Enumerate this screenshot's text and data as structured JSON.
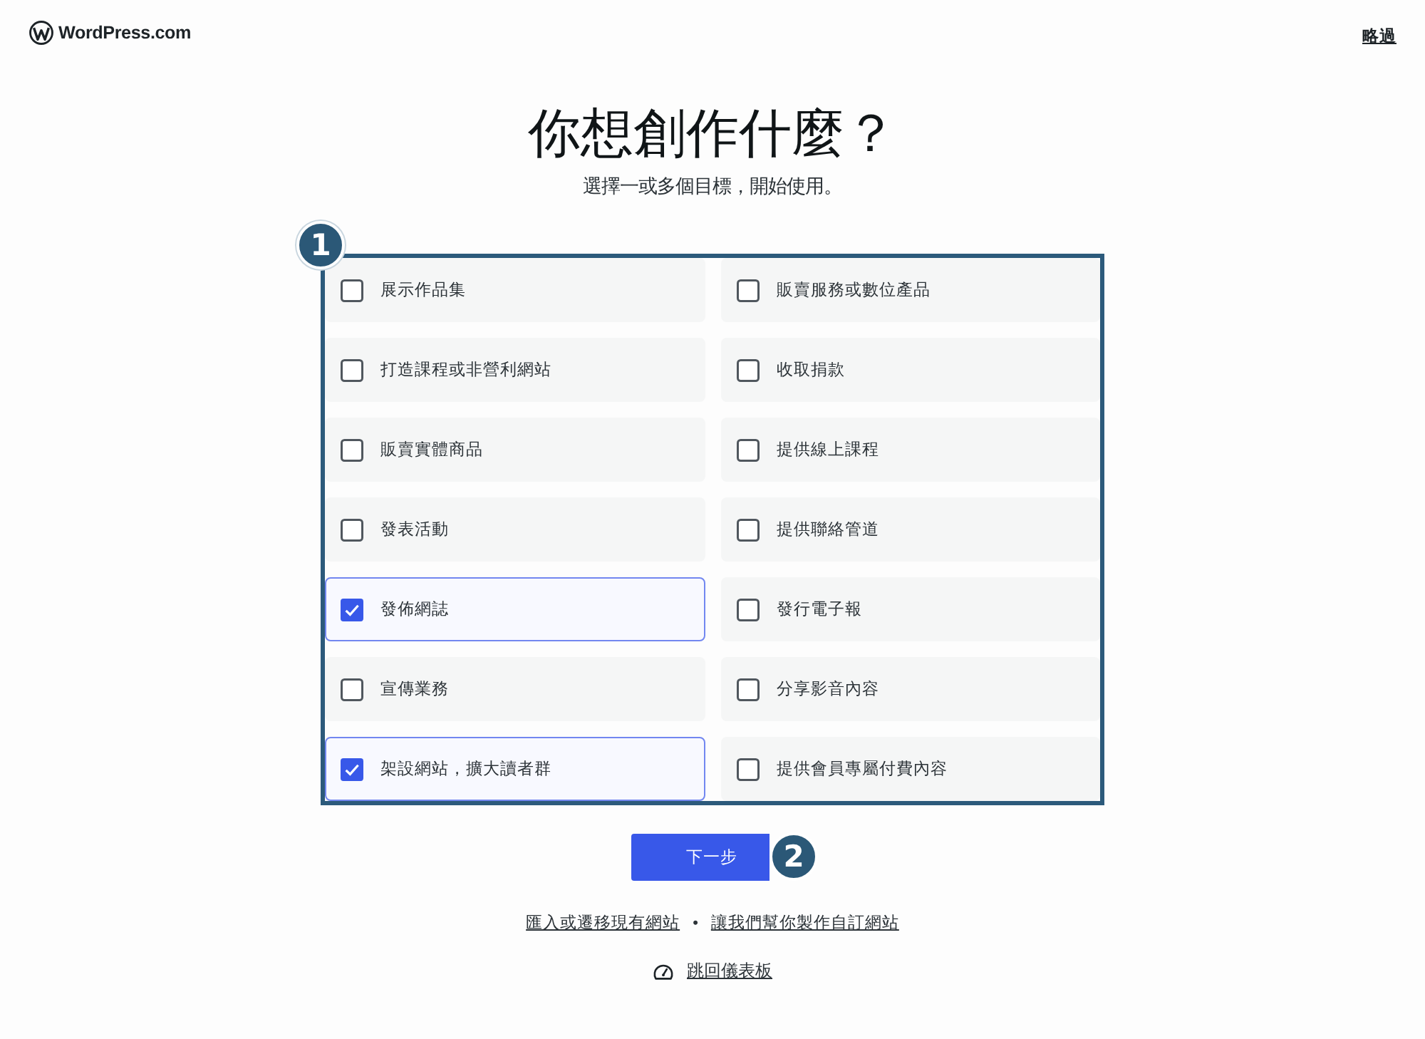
{
  "header": {
    "brand": "WordPress.com",
    "skip_link": "略過"
  },
  "heading": {
    "title": "你想創作什麼？",
    "subtitle": "選擇一或多個目標，開始使用。"
  },
  "goals": {
    "annotation": "1",
    "items": [
      {
        "label": "展示作品集",
        "checked": false
      },
      {
        "label": "販賣服務或數位產品",
        "checked": false
      },
      {
        "label": "打造課程或非營利網站",
        "checked": false
      },
      {
        "label": "收取捐款",
        "checked": false
      },
      {
        "label": "販賣實體商品",
        "checked": false
      },
      {
        "label": "提供線上課程",
        "checked": false
      },
      {
        "label": "發表活動",
        "checked": false
      },
      {
        "label": "提供聯絡管道",
        "checked": false
      },
      {
        "label": "發佈網誌",
        "checked": true
      },
      {
        "label": "發行電子報",
        "checked": false
      },
      {
        "label": "宣傳業務",
        "checked": false
      },
      {
        "label": "分享影音內容",
        "checked": false
      },
      {
        "label": "架設網站，擴大讀者群",
        "checked": true
      },
      {
        "label": "提供會員專屬付費內容",
        "checked": false
      }
    ]
  },
  "next_button": {
    "label": "下一步",
    "annotation": "2"
  },
  "links": [
    "匯入或遷移現有網站",
    "讓我們幫你製作自訂網站"
  ],
  "separator": "•",
  "dashboard_link": "跳回儀表板"
}
